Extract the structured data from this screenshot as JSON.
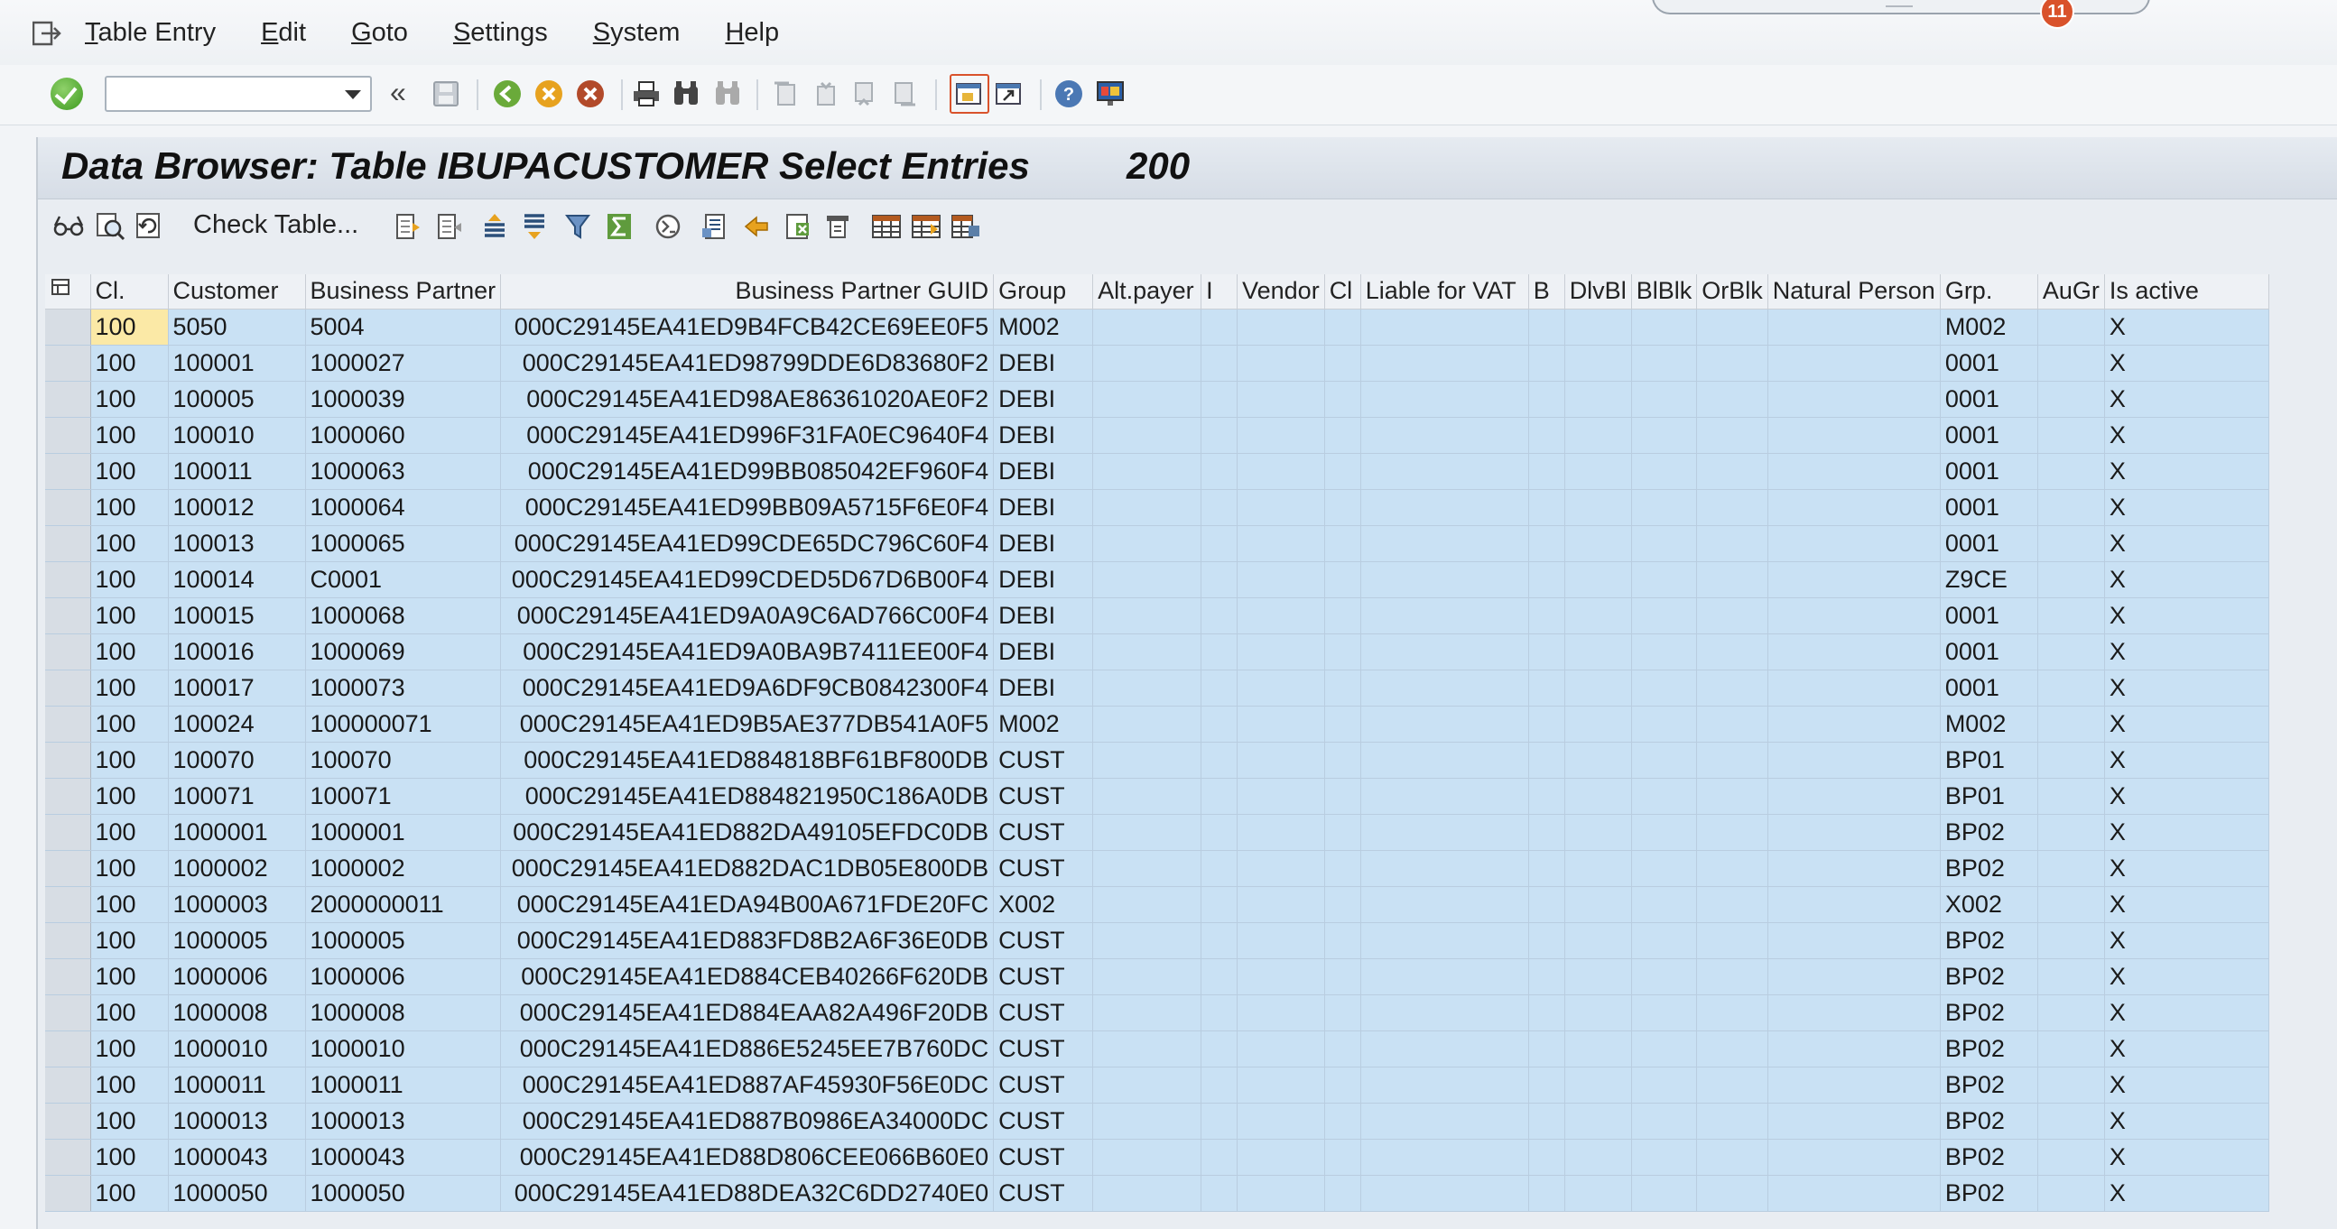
{
  "menu": {
    "items": [
      {
        "label": "Table Entry",
        "u": "T",
        "rest": "able Entry"
      },
      {
        "label": "Edit",
        "u": "E",
        "rest": "dit"
      },
      {
        "label": "Goto",
        "u": "G",
        "rest": "oto"
      },
      {
        "label": "Settings",
        "u": "S",
        "rest": "ettings"
      },
      {
        "label": "System",
        "u": "S",
        "rest": "ystem"
      },
      {
        "label": "Help",
        "u": "H",
        "rest": "elp"
      }
    ],
    "notification_count": "11"
  },
  "toolbar": {
    "command_field_value": "",
    "back_chevron": "«"
  },
  "screen": {
    "title": "Data Browser: Table IBUPACUSTOMER Select Entries",
    "entry_count": "200",
    "check_table_label": "Check Table..."
  },
  "grid": {
    "columns": [
      "Cl.",
      "Customer",
      "Business Partner",
      "Business Partner GUID",
      "Group",
      "Alt.payer",
      "I",
      "Vendor",
      "Cl",
      "Liable for VAT",
      "B",
      "DlvBl",
      "BlBlk",
      "OrBlk",
      "Natural Person",
      "Grp.",
      "AuGr",
      "Is active"
    ],
    "rows": [
      [
        "100",
        "5050",
        "5004",
        "000C29145EA41ED9B4FCB42CE69EE0F5",
        "M002",
        "",
        "",
        "",
        "",
        "",
        "",
        "",
        "",
        "",
        "",
        "M002",
        "",
        "X"
      ],
      [
        "100",
        "100001",
        "1000027",
        "000C29145EA41ED98799DDE6D83680F2",
        "DEBI",
        "",
        "",
        "",
        "",
        "",
        "",
        "",
        "",
        "",
        "",
        "0001",
        "",
        "X"
      ],
      [
        "100",
        "100005",
        "1000039",
        "000C29145EA41ED98AE86361020AE0F2",
        "DEBI",
        "",
        "",
        "",
        "",
        "",
        "",
        "",
        "",
        "",
        "",
        "0001",
        "",
        "X"
      ],
      [
        "100",
        "100010",
        "1000060",
        "000C29145EA41ED996F31FA0EC9640F4",
        "DEBI",
        "",
        "",
        "",
        "",
        "",
        "",
        "",
        "",
        "",
        "",
        "0001",
        "",
        "X"
      ],
      [
        "100",
        "100011",
        "1000063",
        "000C29145EA41ED99BB085042EF960F4",
        "DEBI",
        "",
        "",
        "",
        "",
        "",
        "",
        "",
        "",
        "",
        "",
        "0001",
        "",
        "X"
      ],
      [
        "100",
        "100012",
        "1000064",
        "000C29145EA41ED99BB09A5715F6E0F4",
        "DEBI",
        "",
        "",
        "",
        "",
        "",
        "",
        "",
        "",
        "",
        "",
        "0001",
        "",
        "X"
      ],
      [
        "100",
        "100013",
        "1000065",
        "000C29145EA41ED99CDE65DC796C60F4",
        "DEBI",
        "",
        "",
        "",
        "",
        "",
        "",
        "",
        "",
        "",
        "",
        "0001",
        "",
        "X"
      ],
      [
        "100",
        "100014",
        "C0001",
        "000C29145EA41ED99CDED5D67D6B00F4",
        "DEBI",
        "",
        "",
        "",
        "",
        "",
        "",
        "",
        "",
        "",
        "",
        "Z9CE",
        "",
        "X"
      ],
      [
        "100",
        "100015",
        "1000068",
        "000C29145EA41ED9A0A9C6AD766C00F4",
        "DEBI",
        "",
        "",
        "",
        "",
        "",
        "",
        "",
        "",
        "",
        "",
        "0001",
        "",
        "X"
      ],
      [
        "100",
        "100016",
        "1000069",
        "000C29145EA41ED9A0BA9B7411EE00F4",
        "DEBI",
        "",
        "",
        "",
        "",
        "",
        "",
        "",
        "",
        "",
        "",
        "0001",
        "",
        "X"
      ],
      [
        "100",
        "100017",
        "1000073",
        "000C29145EA41ED9A6DF9CB0842300F4",
        "DEBI",
        "",
        "",
        "",
        "",
        "",
        "",
        "",
        "",
        "",
        "",
        "0001",
        "",
        "X"
      ],
      [
        "100",
        "100024",
        "100000071",
        "000C29145EA41ED9B5AE377DB541A0F5",
        "M002",
        "",
        "",
        "",
        "",
        "",
        "",
        "",
        "",
        "",
        "",
        "M002",
        "",
        "X"
      ],
      [
        "100",
        "100070",
        "100070",
        "000C29145EA41ED884818BF61BF800DB",
        "CUST",
        "",
        "",
        "",
        "",
        "",
        "",
        "",
        "",
        "",
        "",
        "BP01",
        "",
        "X"
      ],
      [
        "100",
        "100071",
        "100071",
        "000C29145EA41ED884821950C186A0DB",
        "CUST",
        "",
        "",
        "",
        "",
        "",
        "",
        "",
        "",
        "",
        "",
        "BP01",
        "",
        "X"
      ],
      [
        "100",
        "1000001",
        "1000001",
        "000C29145EA41ED882DA49105EFDC0DB",
        "CUST",
        "",
        "",
        "",
        "",
        "",
        "",
        "",
        "",
        "",
        "",
        "BP02",
        "",
        "X"
      ],
      [
        "100",
        "1000002",
        "1000002",
        "000C29145EA41ED882DAC1DB05E800DB",
        "CUST",
        "",
        "",
        "",
        "",
        "",
        "",
        "",
        "",
        "",
        "",
        "BP02",
        "",
        "X"
      ],
      [
        "100",
        "1000003",
        "2000000011",
        "000C29145EA41EDA94B00A671FDE20FC",
        "X002",
        "",
        "",
        "",
        "",
        "",
        "",
        "",
        "",
        "",
        "",
        "X002",
        "",
        "X"
      ],
      [
        "100",
        "1000005",
        "1000005",
        "000C29145EA41ED883FD8B2A6F36E0DB",
        "CUST",
        "",
        "",
        "",
        "",
        "",
        "",
        "",
        "",
        "",
        "",
        "BP02",
        "",
        "X"
      ],
      [
        "100",
        "1000006",
        "1000006",
        "000C29145EA41ED884CEB40266F620DB",
        "CUST",
        "",
        "",
        "",
        "",
        "",
        "",
        "",
        "",
        "",
        "",
        "BP02",
        "",
        "X"
      ],
      [
        "100",
        "1000008",
        "1000008",
        "000C29145EA41ED884EAA82A496F20DB",
        "CUST",
        "",
        "",
        "",
        "",
        "",
        "",
        "",
        "",
        "",
        "",
        "BP02",
        "",
        "X"
      ],
      [
        "100",
        "1000010",
        "1000010",
        "000C29145EA41ED886E5245EE7B760DC",
        "CUST",
        "",
        "",
        "",
        "",
        "",
        "",
        "",
        "",
        "",
        "",
        "BP02",
        "",
        "X"
      ],
      [
        "100",
        "1000011",
        "1000011",
        "000C29145EA41ED887AF45930F56E0DC",
        "CUST",
        "",
        "",
        "",
        "",
        "",
        "",
        "",
        "",
        "",
        "",
        "BP02",
        "",
        "X"
      ],
      [
        "100",
        "1000013",
        "1000013",
        "000C29145EA41ED887B0986EA34000DC",
        "CUST",
        "",
        "",
        "",
        "",
        "",
        "",
        "",
        "",
        "",
        "",
        "BP02",
        "",
        "X"
      ],
      [
        "100",
        "1000043",
        "1000043",
        "000C29145EA41ED88D806CEE066B60E0",
        "CUST",
        "",
        "",
        "",
        "",
        "",
        "",
        "",
        "",
        "",
        "",
        "BP02",
        "",
        "X"
      ],
      [
        "100",
        "1000050",
        "1000050",
        "000C29145EA41ED88DEA32C6DD2740E0",
        "CUST",
        "",
        "",
        "",
        "",
        "",
        "",
        "",
        "",
        "",
        "",
        "BP02",
        "",
        "X"
      ]
    ]
  }
}
